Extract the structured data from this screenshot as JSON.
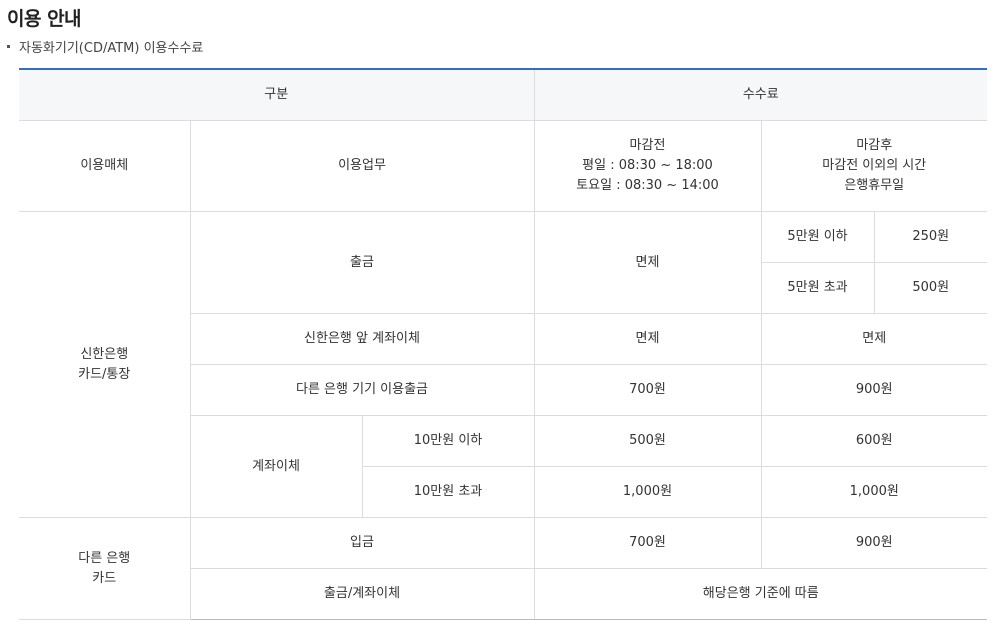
{
  "page": {
    "title": "이용 안내",
    "subtitle": "자동화기기(CD/ATM) 이용수수료"
  },
  "table": {
    "header": {
      "category": "구분",
      "fee": "수수료"
    },
    "subheader": {
      "media": "이용매체",
      "service": "이용업무",
      "before_lines": [
        "마감전",
        "평일 : 08:30 ~ 18:00",
        "토요일 : 08:30 ~ 14:00"
      ],
      "after_lines": [
        "마감후",
        "마감전 이외의 시간",
        "은행휴무일"
      ]
    },
    "shinhan": {
      "media_lines": [
        "신한은행",
        "카드/통장"
      ],
      "withdraw": {
        "label": "출금",
        "before": "면제",
        "after_tiers": [
          {
            "condition": "5만원 이하",
            "fee": "250원"
          },
          {
            "condition": "5만원 초과",
            "fee": "500원"
          }
        ]
      },
      "transfer_shinhan": {
        "label": "신한은행 앞 계좌이체",
        "before": "면제",
        "after": "면제"
      },
      "other_bank_machine": {
        "label": "다른 은행 기기 이용출금",
        "before": "700원",
        "after": "900원"
      },
      "transfer": {
        "label": "계좌이체",
        "tiers": [
          {
            "condition": "10만원 이하",
            "before": "500원",
            "after": "600원"
          },
          {
            "condition": "10만원 초과",
            "before": "1,000원",
            "after": "1,000원"
          }
        ]
      }
    },
    "other_card": {
      "media_lines": [
        "다른 은행",
        "카드"
      ],
      "deposit": {
        "label": "입금",
        "before": "700원",
        "after": "900원"
      },
      "withdraw_transfer": {
        "label": "출금/계좌이체",
        "fee": "해당은행 기준에 따름"
      }
    }
  }
}
